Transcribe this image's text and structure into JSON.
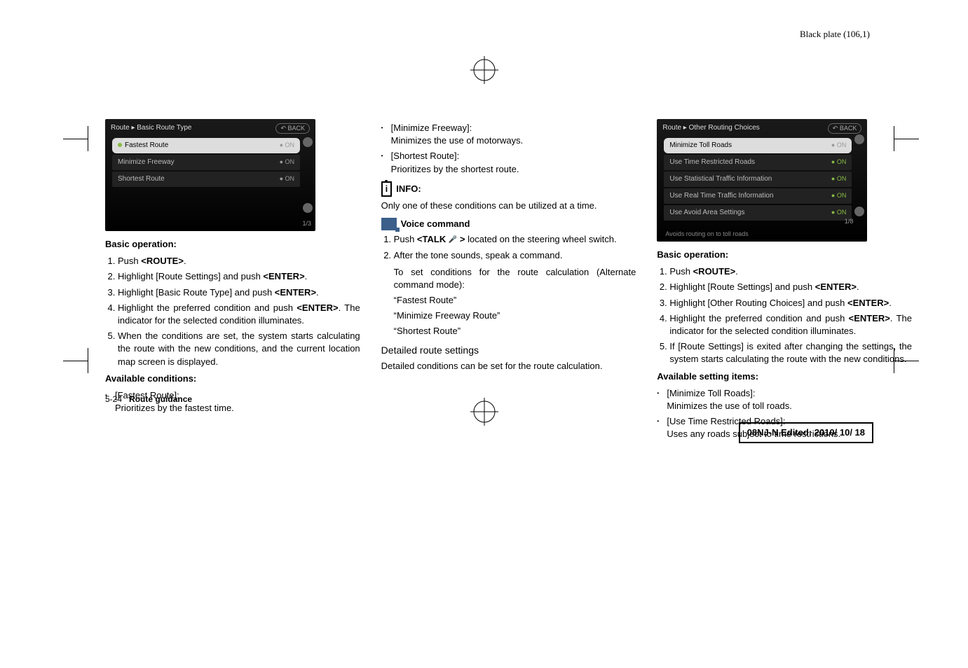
{
  "header": {
    "plate": "Black plate (106,1)"
  },
  "col1": {
    "screenshot": {
      "title": "Route ▸ Basic Route Type",
      "back": "↶ BACK",
      "rows": [
        {
          "label": "Fastest Route",
          "on": "ON",
          "sel": true,
          "dot": "#8b4"
        },
        {
          "label": "Minimize Freeway",
          "on": "ON",
          "sel": false,
          "dot": "#555"
        },
        {
          "label": "Shortest Route",
          "on": "ON",
          "sel": false,
          "dot": "#555"
        }
      ],
      "page": "1/3"
    },
    "basic_op_head": "Basic operation:",
    "list": [
      "Push <ROUTE>.",
      "Highlight [Route Settings] and push <ENTER>.",
      "Highlight [Basic Route Type] and push <ENTER>.",
      "Highlight the preferred condition and push <ENTER>. The indicator for the selected condition illuminates.",
      "When the conditions are set, the system starts calculating the route with the new conditions, and the current location map screen is displayed."
    ],
    "avail_head": "Available conditions:",
    "avail": [
      {
        "t": "[Fastest Route]:",
        "d": "Prioritizes by the fastest time."
      }
    ]
  },
  "col2": {
    "bullets_top": [
      {
        "t": "[Minimize Freeway]:",
        "d": "Minimizes the use of motorways."
      },
      {
        "t": "[Shortest Route]:",
        "d": "Prioritizes by the shortest route."
      }
    ],
    "info_label": "INFO:",
    "info_text": "Only one of these conditions can be utilized at a time.",
    "voice_label": "Voice command",
    "voice_list": [
      "Push <TALK  > located on the steering wheel switch.",
      "After the tone sounds, speak a command."
    ],
    "voice_para": "To set conditions for the route calculation (Alternate command mode):",
    "voice_quotes": [
      "“Fastest Route”",
      "“Minimize Freeway Route”",
      "“Shortest Route”"
    ],
    "detailed_title": "Detailed route settings",
    "detailed_text": "Detailed conditions can be set for the route calculation."
  },
  "col3": {
    "screenshot": {
      "title": "Route ▸ Other Routing Choices",
      "back": "↶ BACK",
      "rows": [
        {
          "label": "Minimize Toll Roads",
          "on": "ON",
          "sel": true,
          "dot": "#555"
        },
        {
          "label": "Use Time Restricted Roads",
          "on": "ON",
          "sel": false,
          "dot": "#8b4"
        },
        {
          "label": "Use Statistical Traffic Information",
          "on": "ON",
          "sel": false,
          "dot": "#8b4"
        },
        {
          "label": "Use Real Time Traffic Information",
          "on": "ON",
          "sel": false,
          "dot": "#8b4"
        },
        {
          "label": "Use Avoid Area Settings",
          "on": "ON",
          "sel": false,
          "dot": "#8b4"
        }
      ],
      "page": "1/8",
      "status": "Avoids routing on to toll roads"
    },
    "basic_op_head": "Basic operation:",
    "list": [
      "Push <ROUTE>.",
      "Highlight [Route Settings] and push <ENTER>.",
      "Highlight [Other Routing Choices] and push <ENTER>.",
      "Highlight the preferred condition and push <ENTER>. The indicator for the selected condition illuminates.",
      "If [Route Settings] is exited after changing the settings, the system starts calculating the route with the new conditions."
    ],
    "avail_head": "Available setting items:",
    "avail": [
      {
        "t": "[Minimize Toll Roads]:",
        "d": "Minimizes the use of toll roads."
      },
      {
        "t": "[Use Time Restricted Roads]:",
        "d": "Uses any roads subject to time restrictions."
      }
    ]
  },
  "footer": {
    "left_page": "5-24",
    "left_title": "Route guidance",
    "box": "08NJ-N Edited:  2010/ 10/ 18"
  }
}
